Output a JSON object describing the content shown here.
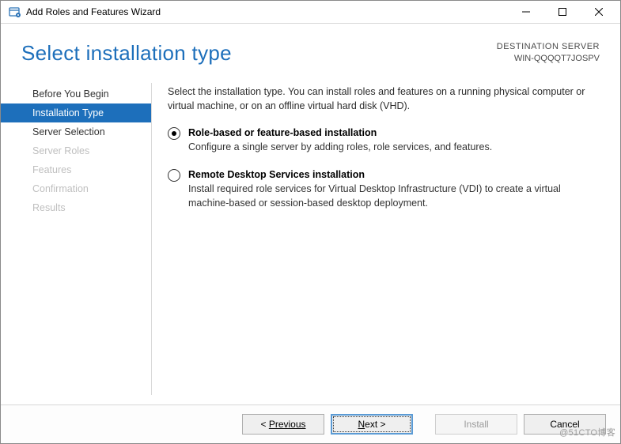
{
  "window": {
    "title": "Add Roles and Features Wizard"
  },
  "header": {
    "page_title": "Select installation type",
    "destination_label": "DESTINATION SERVER",
    "destination_value": "WIN-QQQQT7JOSPV"
  },
  "sidebar": {
    "items": [
      {
        "label": "Before You Begin",
        "active": false,
        "disabled": false
      },
      {
        "label": "Installation Type",
        "active": true,
        "disabled": false
      },
      {
        "label": "Server Selection",
        "active": false,
        "disabled": false
      },
      {
        "label": "Server Roles",
        "active": false,
        "disabled": true
      },
      {
        "label": "Features",
        "active": false,
        "disabled": true
      },
      {
        "label": "Confirmation",
        "active": false,
        "disabled": true
      },
      {
        "label": "Results",
        "active": false,
        "disabled": true
      }
    ]
  },
  "main": {
    "intro": "Select the installation type. You can install roles and features on a running physical computer or virtual machine, or on an offline virtual hard disk (VHD).",
    "options": [
      {
        "title": "Role-based or feature-based installation",
        "desc": "Configure a single server by adding roles, role services, and features.",
        "selected": true
      },
      {
        "title": "Remote Desktop Services installation",
        "desc": "Install required role services for Virtual Desktop Infrastructure (VDI) to create a virtual machine-based or session-based desktop deployment.",
        "selected": false
      }
    ]
  },
  "footer": {
    "previous": "Previous",
    "next": "Next >",
    "install": "Install",
    "cancel": "Cancel"
  },
  "watermark": "@51CTO博客"
}
